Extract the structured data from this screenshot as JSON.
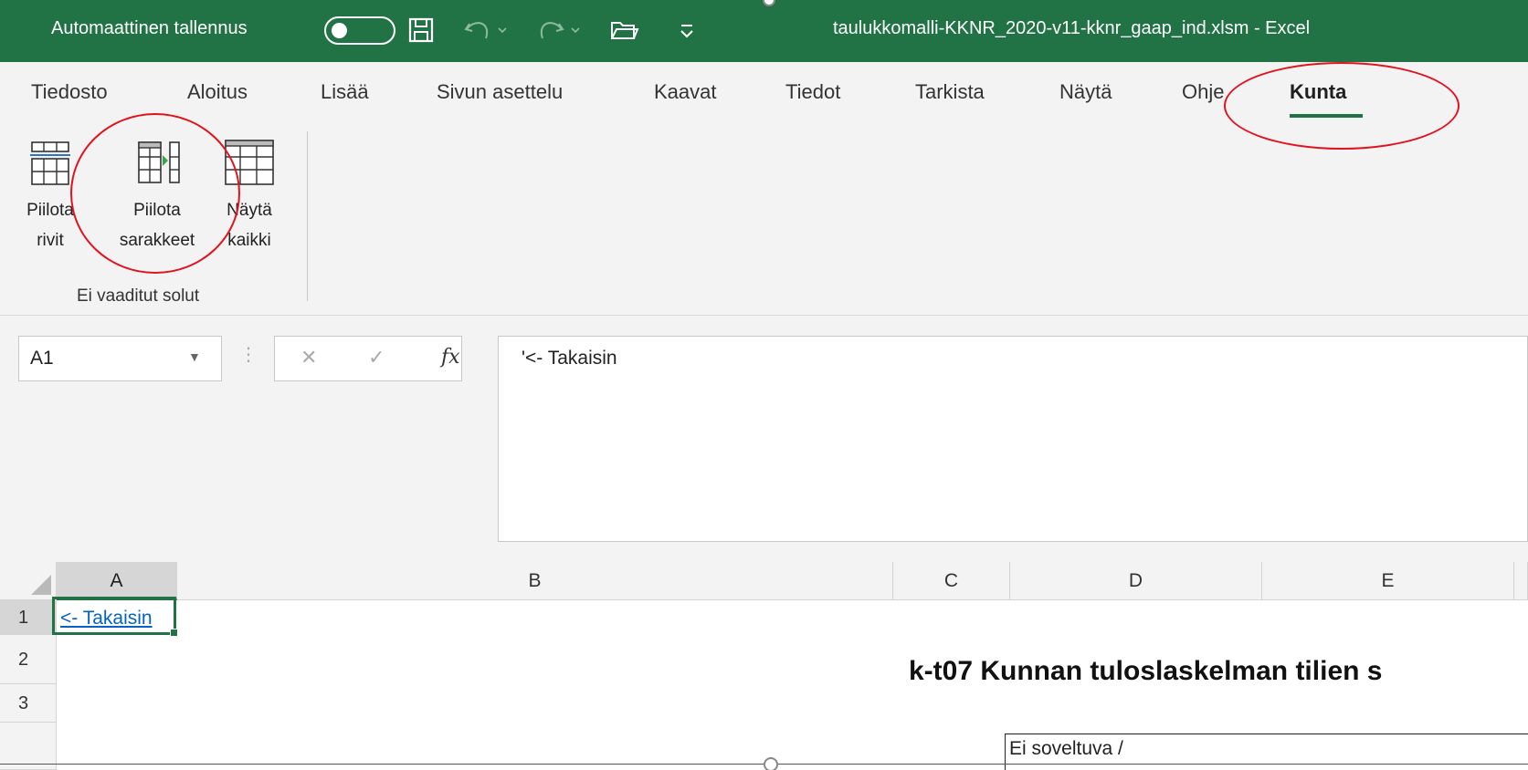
{
  "titlebar": {
    "autosave_label": "Automaattinen tallennus",
    "filename": "taulukkomalli-KKNR_2020-v11-kknr_gaap_ind.xlsm  -  Excel",
    "icons": [
      "toggle-icon",
      "save-icon",
      "undo-icon",
      "redo-icon",
      "open-folder-icon",
      "customize-qat-icon"
    ]
  },
  "ribbon": {
    "tabs": [
      {
        "label": "Tiedosto"
      },
      {
        "label": "Aloitus"
      },
      {
        "label": "Lisää"
      },
      {
        "label": "Sivun asettelu"
      },
      {
        "label": "Kaavat"
      },
      {
        "label": "Tiedot"
      },
      {
        "label": "Tarkista"
      },
      {
        "label": "Näytä"
      },
      {
        "label": "Ohje"
      },
      {
        "label": "Kunta"
      }
    ],
    "active_tab": "Kunta",
    "buttons": [
      {
        "line1": "Piilota",
        "line2": "rivit",
        "icon": "hide-rows-icon"
      },
      {
        "line1": "Piilota",
        "line2": "sarakkeet",
        "icon": "hide-columns-icon"
      },
      {
        "line1": "Näytä",
        "line2": "kaikki",
        "icon": "show-all-icon"
      }
    ],
    "group_label": "Ei vaaditut solut"
  },
  "formula_bar": {
    "name_box": "A1",
    "cancel_glyph": "✕",
    "enter_glyph": "✓",
    "fx_glyph": "fx",
    "content": "'<- Takaisin"
  },
  "grid": {
    "columns": [
      "A",
      "B",
      "C",
      "D",
      "E"
    ],
    "selected_column": "A",
    "rows": [
      "1",
      "2",
      "3"
    ],
    "cells": {
      "A1": "<- Takaisin",
      "title": "k-t07  Kunnan tuloslaskelman tilien s",
      "box_text": "Ei soveltuva /"
    }
  },
  "colors": {
    "accent": "#217346",
    "link": "#0563c1",
    "annotation": "#e0141e"
  }
}
